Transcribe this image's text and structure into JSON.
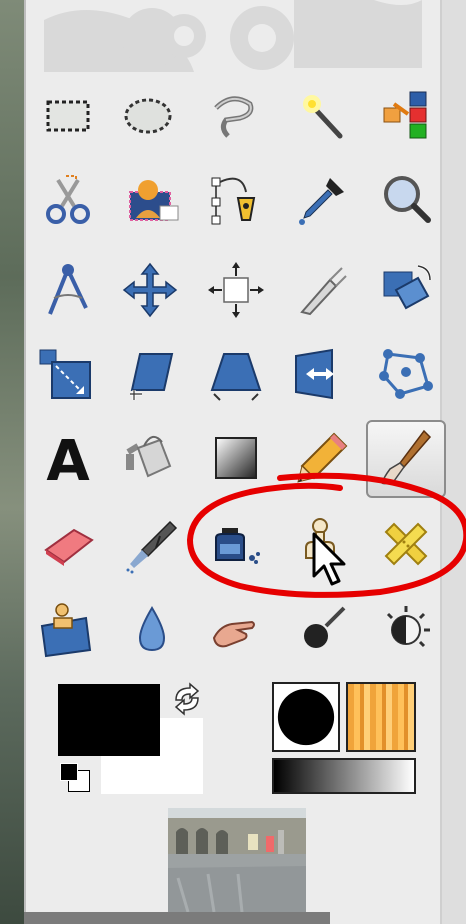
{
  "colors": {
    "panel_bg": "#ececec",
    "icon_blue": "#3d6fb0",
    "annotation_red": "#e60000",
    "foreground_color": "#000000",
    "background_color": "#ffffff"
  },
  "toolbox": {
    "tools": [
      {
        "icon": "rect-select-icon"
      },
      {
        "icon": "ellipse-select-icon"
      },
      {
        "icon": "free-select-lasso-icon"
      },
      {
        "icon": "fuzzy-select-wand-icon"
      },
      {
        "icon": "select-by-color-icon"
      },
      {
        "icon": "scissors-select-icon"
      },
      {
        "icon": "foreground-select-icon"
      },
      {
        "icon": "paths-pen-icon"
      },
      {
        "icon": "color-picker-eyedropper-icon"
      },
      {
        "icon": "zoom-magnifier-icon"
      },
      {
        "icon": "measure-compass-icon"
      },
      {
        "icon": "move-arrows-icon"
      },
      {
        "icon": "alignment-icon"
      },
      {
        "icon": "crop-knife-icon"
      },
      {
        "icon": "rotate-icon"
      },
      {
        "icon": "scale-icon"
      },
      {
        "icon": "shear-icon"
      },
      {
        "icon": "perspective-icon"
      },
      {
        "icon": "flip-icon"
      },
      {
        "icon": "cage-transform-icon"
      },
      {
        "icon": "text-tool-icon",
        "glyph": "A"
      },
      {
        "icon": "bucket-fill-icon"
      },
      {
        "icon": "blend-gradient-icon"
      },
      {
        "icon": "pencil-icon"
      },
      {
        "icon": "paintbrush-icon",
        "active": true
      },
      {
        "icon": "eraser-icon"
      },
      {
        "icon": "airbrush-icon"
      },
      {
        "icon": "ink-icon"
      },
      {
        "icon": "clone-stamp-icon"
      },
      {
        "icon": "heal-bandage-icon"
      },
      {
        "icon": "perspective-clone-icon"
      },
      {
        "icon": "blur-sharpen-drop-icon"
      },
      {
        "icon": "smudge-finger-icon"
      },
      {
        "icon": "dodge-burn-icon"
      },
      {
        "icon": "gegl-operation-icon"
      }
    ],
    "highlighted_tools": [
      "ink-icon",
      "clone-stamp-icon",
      "heal-bandage-icon"
    ]
  }
}
